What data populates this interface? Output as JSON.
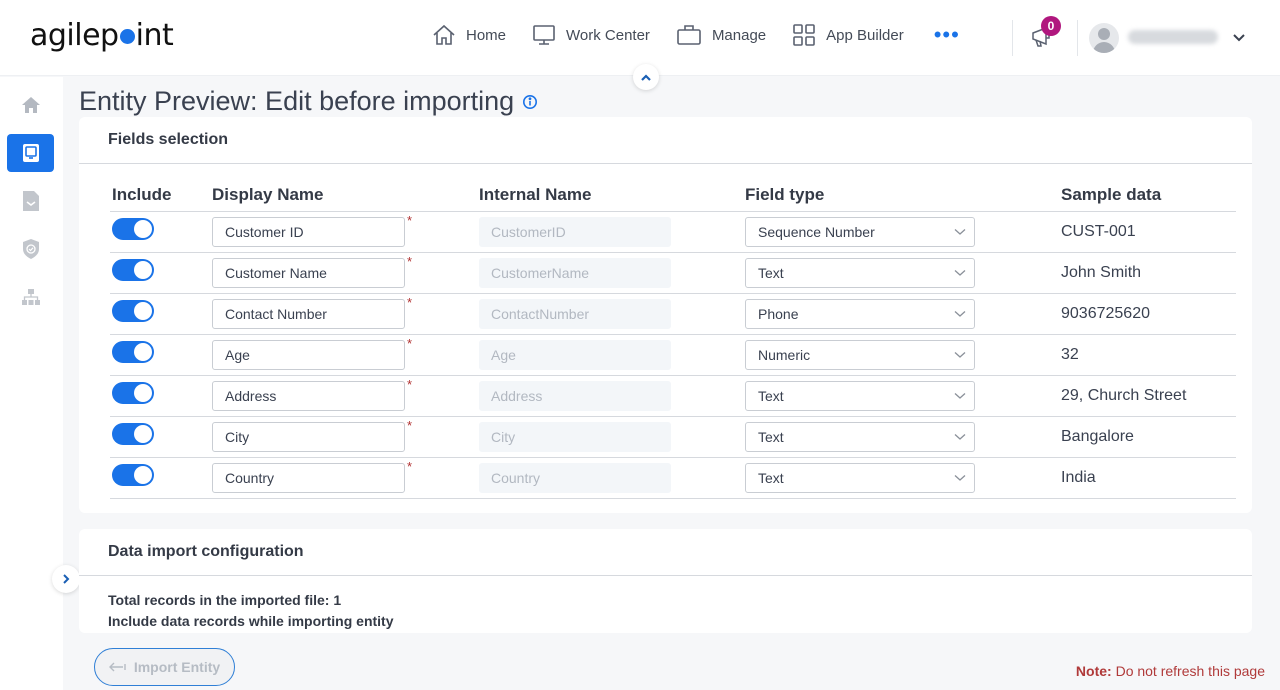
{
  "header": {
    "logo_left": "agilep",
    "logo_right": "int",
    "nav": [
      {
        "label": "Home",
        "icon": "home-icon"
      },
      {
        "label": "Work Center",
        "icon": "monitor-icon"
      },
      {
        "label": "Manage",
        "icon": "briefcase-icon"
      },
      {
        "label": "App Builder",
        "icon": "grid-icon"
      }
    ],
    "more_label": "•••",
    "notification_count": "0"
  },
  "sidebar": {
    "items": [
      {
        "name": "home",
        "icon": "home-icon",
        "active": false
      },
      {
        "name": "data-entities",
        "icon": "monitor-icon",
        "active": true
      },
      {
        "name": "documents",
        "icon": "document-icon",
        "active": false
      },
      {
        "name": "security",
        "icon": "shield-icon",
        "active": false
      },
      {
        "name": "hierarchy",
        "icon": "hierarchy-icon",
        "active": false
      }
    ]
  },
  "page": {
    "title": "Entity Preview: Edit before importing"
  },
  "fields_selection": {
    "title": "Fields selection",
    "columns": [
      "Include",
      "Display Name",
      "Internal Name",
      "Field type",
      "Sample data"
    ],
    "rows": [
      {
        "include": true,
        "display_name": "Customer ID",
        "internal_name": "CustomerID",
        "field_type": "Sequence Number",
        "sample": "CUST-001"
      },
      {
        "include": true,
        "display_name": "Customer Name",
        "internal_name": "CustomerName",
        "field_type": "Text",
        "sample": "John Smith"
      },
      {
        "include": true,
        "display_name": "Contact Number",
        "internal_name": "ContactNumber",
        "field_type": "Phone",
        "sample": "9036725620"
      },
      {
        "include": true,
        "display_name": "Age",
        "internal_name": "Age",
        "field_type": "Numeric",
        "sample": "32"
      },
      {
        "include": true,
        "display_name": "Address",
        "internal_name": "Address",
        "field_type": "Text",
        "sample": "29, Church Street"
      },
      {
        "include": true,
        "display_name": "City",
        "internal_name": "City",
        "field_type": "Text",
        "sample": "Bangalore"
      },
      {
        "include": true,
        "display_name": "Country",
        "internal_name": "Country",
        "field_type": "Text",
        "sample": "India"
      }
    ],
    "required_marker": "*"
  },
  "data_import": {
    "title": "Data import configuration",
    "total_records": "Total records in the imported file: 1",
    "include_records": "Include data records while importing entity"
  },
  "footer": {
    "import_button": "Import Entity",
    "note_label": "Note:",
    "note_text": " Do not refresh this page"
  },
  "colors": {
    "accent": "#1a73e8",
    "badge": "#b0177e",
    "note": "#b03a3a"
  }
}
